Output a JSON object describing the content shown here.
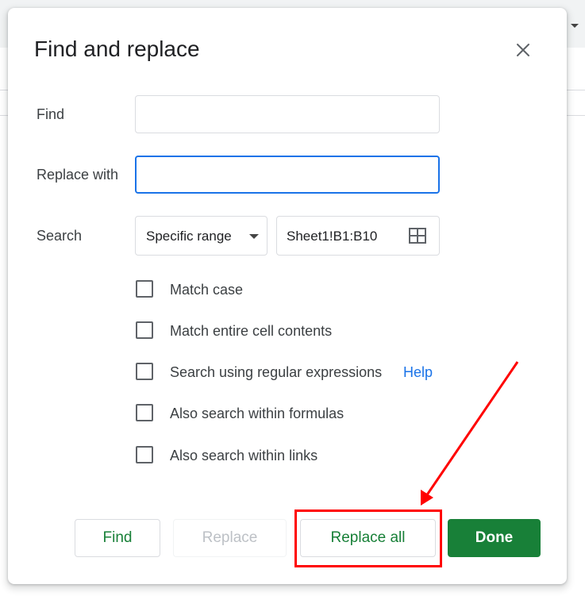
{
  "dialog": {
    "title": "Find and replace",
    "find_label": "Find",
    "find_value": "",
    "replace_label": "Replace with",
    "replace_value": "",
    "search_label": "Search",
    "search_scope": "Specific range",
    "range_value": "Sheet1!B1:B10",
    "options": [
      {
        "label": "Match case",
        "checked": false
      },
      {
        "label": "Match entire cell contents",
        "checked": false
      },
      {
        "label": "Search using regular expressions",
        "checked": false
      },
      {
        "label": "Also search within formulas",
        "checked": false
      },
      {
        "label": "Also search within links",
        "checked": false
      }
    ],
    "help_link": "Help",
    "buttons": {
      "find": "Find",
      "replace": "Replace",
      "replace_all": "Replace all",
      "done": "Done"
    }
  },
  "icons": {
    "close": "close-icon",
    "dropdown": "caret-down-icon",
    "range_picker": "grid-icon"
  },
  "colors": {
    "accent_green": "#188038",
    "focus_blue": "#1a73e8",
    "link_blue": "#1a73e8",
    "annotation_red": "#ff0000"
  }
}
